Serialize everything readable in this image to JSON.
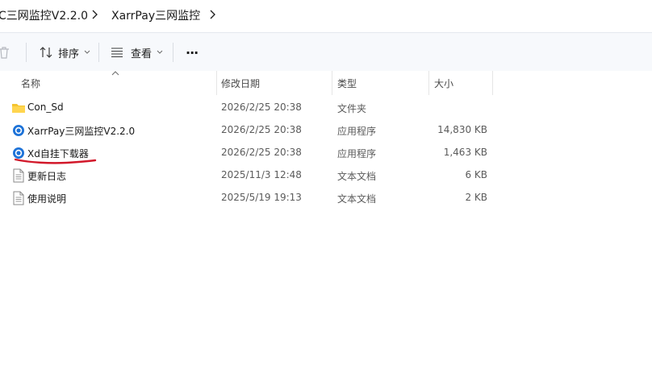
{
  "breadcrumb": {
    "items": [
      {
        "label": "C三网监控V2.2.0"
      },
      {
        "label": "XarrPay三网监控"
      }
    ]
  },
  "toolbar": {
    "sort_label": "排序",
    "view_label": "查看",
    "more_label": "···"
  },
  "columns": {
    "name": "名称",
    "date": "修改日期",
    "type": "类型",
    "size": "大小"
  },
  "files": [
    {
      "name": "Con_Sd",
      "date": "2026/2/25 20:38",
      "type": "文件夹",
      "size": "",
      "icon": "folder-icon"
    },
    {
      "name": "XarrPay三网监控V2.2.0",
      "date": "2026/2/25 20:38",
      "type": "应用程序",
      "size": "14,830 KB",
      "icon": "app-icon"
    },
    {
      "name": "Xd自挂下载器",
      "date": "2026/2/25 20:38",
      "type": "应用程序",
      "size": "1,463 KB",
      "icon": "app-icon"
    },
    {
      "name": "更新日志",
      "date": "2025/11/3 12:48",
      "type": "文本文档",
      "size": "6 KB",
      "icon": "text-file-icon"
    },
    {
      "name": "使用说明",
      "date": "2025/5/19 19:13",
      "type": "文本文档",
      "size": "2 KB",
      "icon": "text-file-icon"
    }
  ],
  "colors": {
    "folder": "#f4c430",
    "app_icon": "#1e73d8",
    "annotation": "#d2182a"
  }
}
